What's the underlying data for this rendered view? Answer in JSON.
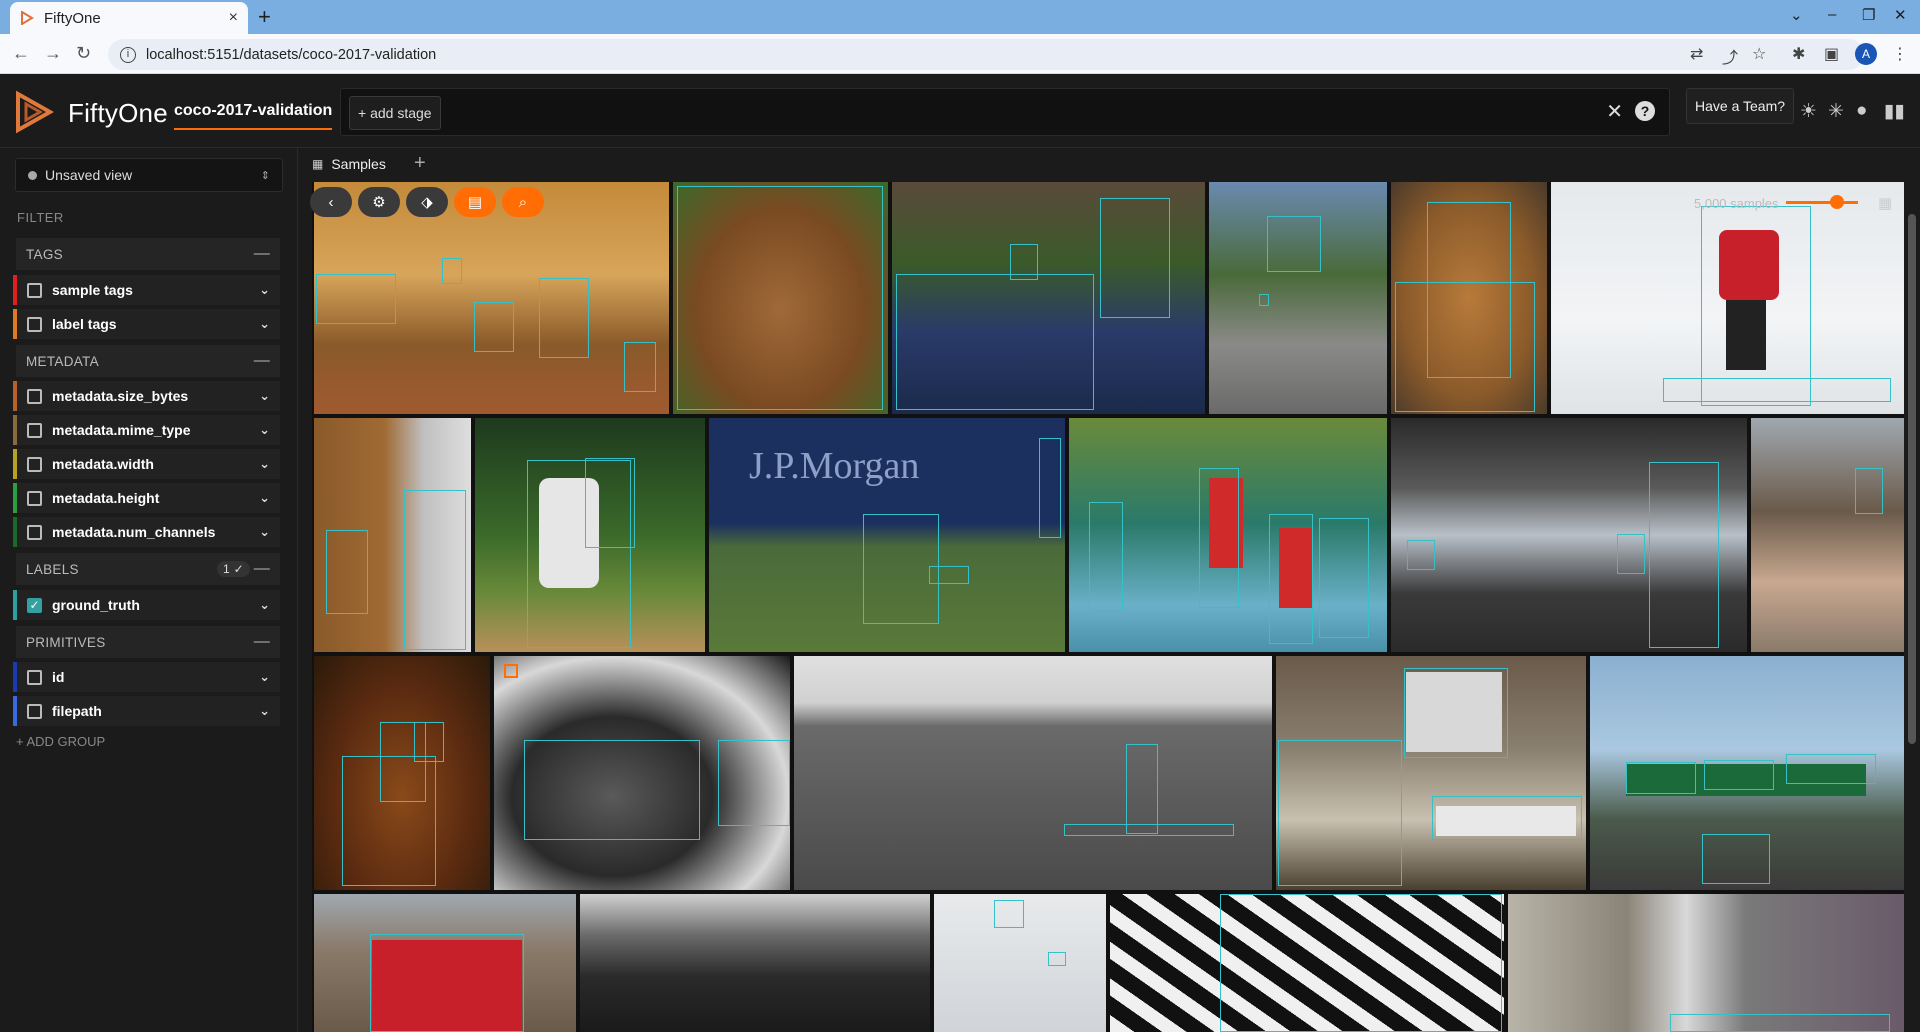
{
  "browser": {
    "tab_title": "FiftyOne",
    "tab_close": "×",
    "new_tab": "+",
    "url": "localhost:5151/datasets/coco-2017-validation",
    "window_controls": [
      "⌄",
      "–",
      "❐",
      "✕"
    ],
    "nav_icons": [
      "back-arrow-icon",
      "forward-arrow-icon",
      "reload-icon"
    ],
    "profile_initial": "A"
  },
  "header": {
    "brand": "FiftyOne",
    "dataset": "coco-2017-validation",
    "add_stage": "+ add stage",
    "clear": "✕",
    "help": "?",
    "team_button": "Have a Team?",
    "accent_color": "#ff6d04"
  },
  "sidebar": {
    "view_selector": "Unsaved view",
    "filter_label": "FILTER",
    "groups": {
      "tags": "TAGS",
      "metadata": "METADATA",
      "labels": "LABELS",
      "labels_badge": "1 ✓",
      "primitives": "PRIMITIVES"
    },
    "fields": {
      "sample_tags": "sample tags",
      "label_tags": "label tags",
      "size_bytes": "metadata.size_bytes",
      "mime_type": "metadata.mime_type",
      "width": "metadata.width",
      "height": "metadata.height",
      "num_channels": "metadata.num_channels",
      "ground_truth": "ground_truth",
      "id": "id",
      "filepath": "filepath"
    },
    "add_group": "+ ADD GROUP"
  },
  "panel": {
    "samples_tab": "Samples",
    "add_panel": "+",
    "sample_count": "5,000 samples"
  }
}
